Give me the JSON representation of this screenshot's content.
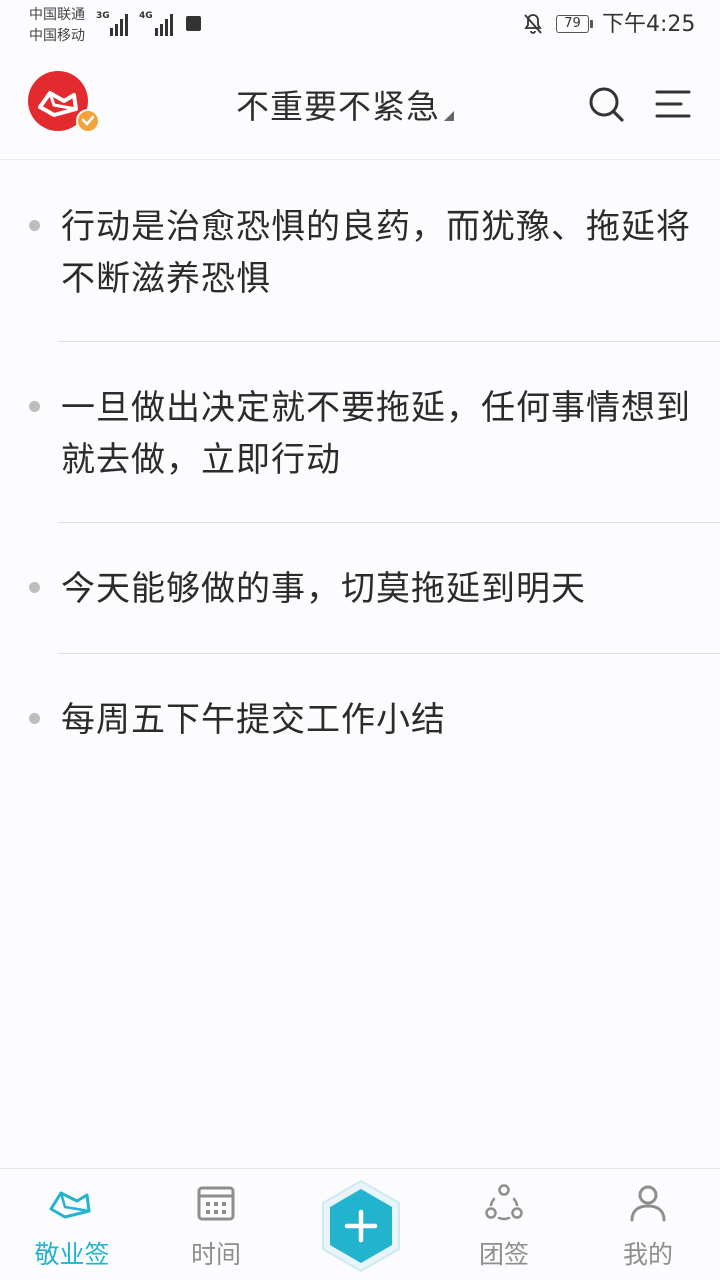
{
  "status_bar": {
    "carrier1": "中国联通",
    "carrier2": "中国移动",
    "net1": "3G",
    "net2": "4G",
    "battery": "79",
    "time": "下午4:25"
  },
  "header": {
    "title": "不重要不紧急",
    "logo_icon": "app-logo-icon",
    "search_icon": "search-icon",
    "menu_icon": "menu-icon"
  },
  "notes": [
    {
      "text": "行动是治愈恐惧的良药，而犹豫、拖延将不断滋养恐惧"
    },
    {
      "text": "一旦做出决定就不要拖延，任何事情想到就去做，立即行动"
    },
    {
      "text": "今天能够做的事，切莫拖延到明天"
    },
    {
      "text": "每周五下午提交工作小结"
    }
  ],
  "nav": {
    "items": [
      {
        "label": "敬业签",
        "icon": "notes-icon"
      },
      {
        "label": "时间",
        "icon": "calendar-icon"
      },
      {
        "label": "团签",
        "icon": "team-icon"
      },
      {
        "label": "我的",
        "icon": "profile-icon"
      }
    ],
    "add_icon": "plus-icon",
    "active_color": "#22b3cf",
    "inactive_color": "#8e8e8e"
  },
  "colors": {
    "accent": "#22b3cf",
    "logo_red": "#e32b2f",
    "badge_orange": "#f2a33a"
  }
}
